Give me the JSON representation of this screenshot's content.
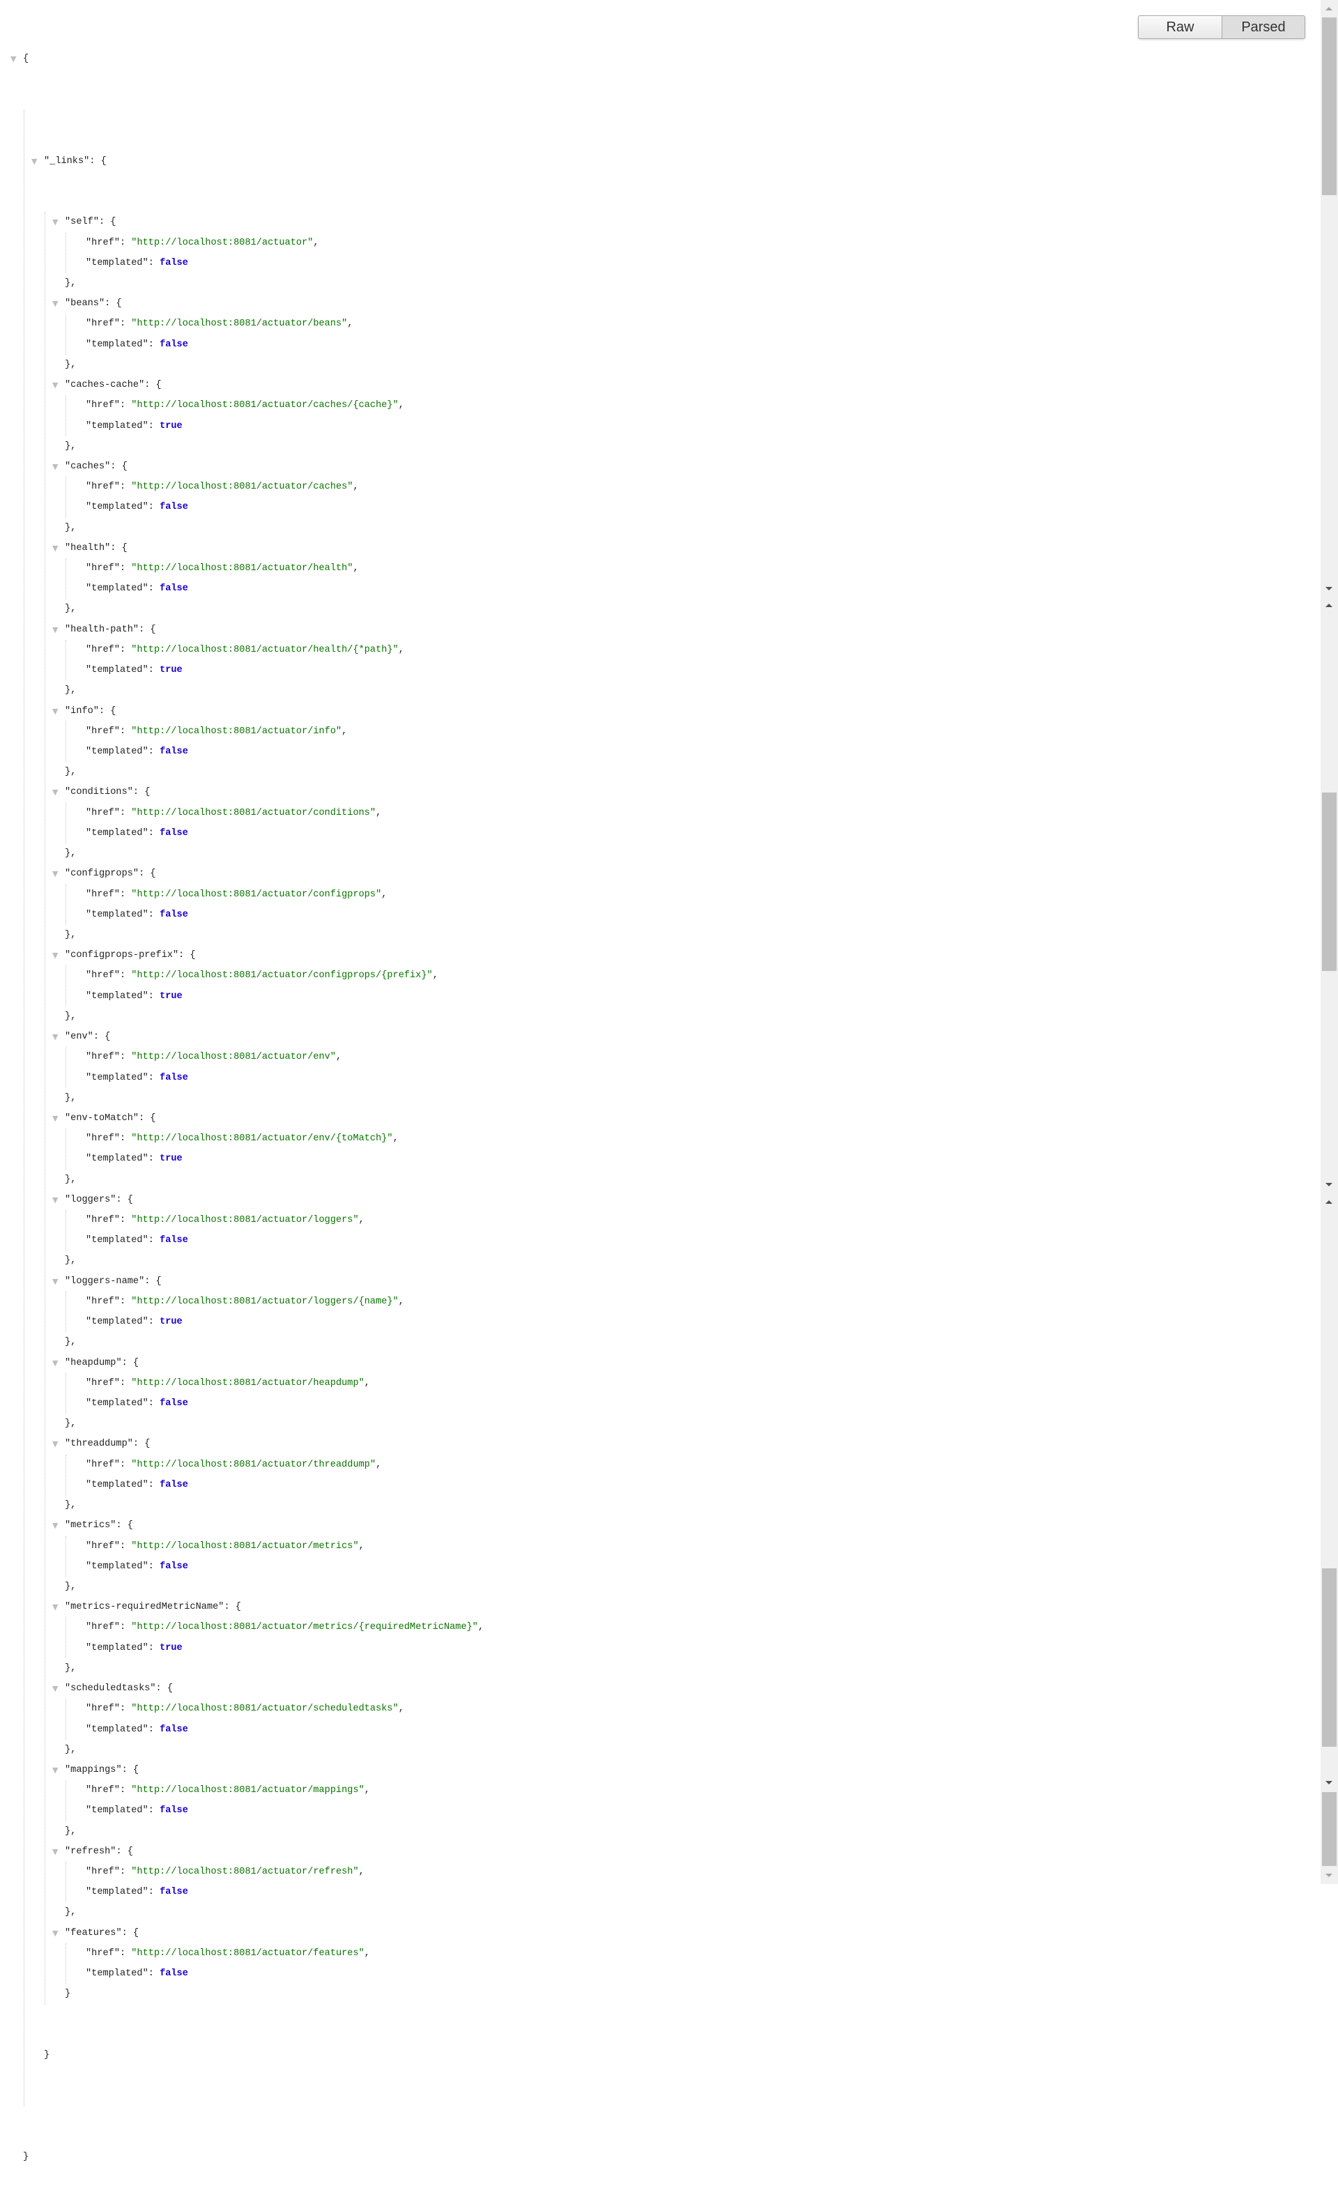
{
  "toolbar": {
    "raw_label": "Raw",
    "parsed_label": "Parsed",
    "active": "Parsed"
  },
  "root_key": "_links",
  "href_key": "href",
  "templated_key": "templated",
  "entries": [
    {
      "name": "self",
      "href": "http://localhost:8081/actuator",
      "templated": "false"
    },
    {
      "name": "beans",
      "href": "http://localhost:8081/actuator/beans",
      "templated": "false"
    },
    {
      "name": "caches-cache",
      "href": "http://localhost:8081/actuator/caches/{cache}",
      "templated": "true"
    },
    {
      "name": "caches",
      "href": "http://localhost:8081/actuator/caches",
      "templated": "false"
    },
    {
      "name": "health",
      "href": "http://localhost:8081/actuator/health",
      "templated": "false"
    },
    {
      "name": "health-path",
      "href": "http://localhost:8081/actuator/health/{*path}",
      "templated": "true"
    },
    {
      "name": "info",
      "href": "http://localhost:8081/actuator/info",
      "templated": "false"
    },
    {
      "name": "conditions",
      "href": "http://localhost:8081/actuator/conditions",
      "templated": "false"
    },
    {
      "name": "configprops",
      "href": "http://localhost:8081/actuator/configprops",
      "templated": "false"
    },
    {
      "name": "configprops-prefix",
      "href": "http://localhost:8081/actuator/configprops/{prefix}",
      "templated": "true"
    },
    {
      "name": "env",
      "href": "http://localhost:8081/actuator/env",
      "templated": "false"
    },
    {
      "name": "env-toMatch",
      "href": "http://localhost:8081/actuator/env/{toMatch}",
      "templated": "true"
    },
    {
      "name": "loggers",
      "href": "http://localhost:8081/actuator/loggers",
      "templated": "false"
    },
    {
      "name": "loggers-name",
      "href": "http://localhost:8081/actuator/loggers/{name}",
      "templated": "true"
    },
    {
      "name": "heapdump",
      "href": "http://localhost:8081/actuator/heapdump",
      "templated": "false"
    },
    {
      "name": "threaddump",
      "href": "http://localhost:8081/actuator/threaddump",
      "templated": "false"
    },
    {
      "name": "metrics",
      "href": "http://localhost:8081/actuator/metrics",
      "templated": "false"
    },
    {
      "name": "metrics-requiredMetricName",
      "href": "http://localhost:8081/actuator/metrics/{requiredMetricName}",
      "templated": "true"
    },
    {
      "name": "scheduledtasks",
      "href": "http://localhost:8081/actuator/scheduledtasks",
      "templated": "false"
    },
    {
      "name": "mappings",
      "href": "http://localhost:8081/actuator/mappings",
      "templated": "false"
    },
    {
      "name": "refresh",
      "href": "http://localhost:8081/actuator/refresh",
      "templated": "false"
    },
    {
      "name": "features",
      "href": "http://localhost:8081/actuator/features",
      "templated": "false"
    }
  ],
  "colors": {
    "string": "#0b7500",
    "boolean": "#1a01cc",
    "key": "#222222"
  }
}
